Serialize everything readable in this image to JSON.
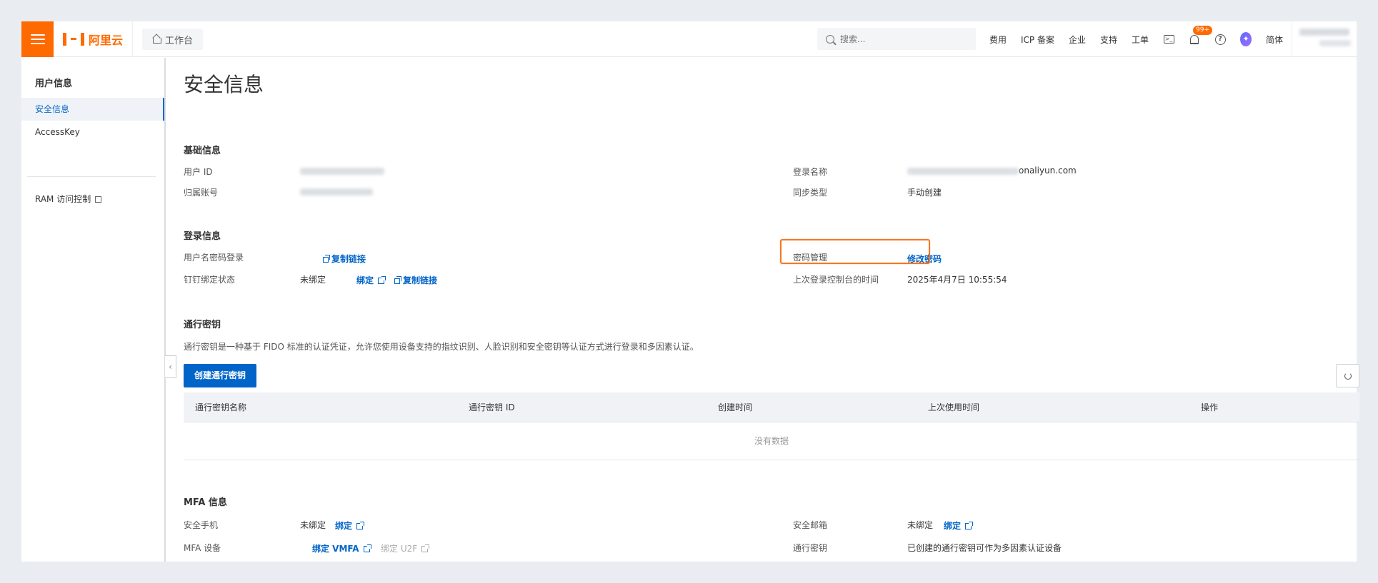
{
  "header": {
    "brand": "阿里云",
    "workbench_label": "工作台",
    "search_placeholder": "搜索...",
    "links": [
      "费用",
      "ICP 备案",
      "企业",
      "支持",
      "工单"
    ],
    "notification_badge": "99+",
    "language": "简体",
    "accent_color": "#ff6a00"
  },
  "sidebar": {
    "title": "用户信息",
    "items": [
      {
        "label": "安全信息",
        "active": true
      },
      {
        "label": "AccessKey",
        "active": false
      },
      {
        "label": "RAM 访问控制",
        "active": false
      }
    ]
  },
  "page": {
    "title": "安全信息",
    "basic": {
      "title": "基础信息",
      "user_id_label": "用户 ID",
      "account_label": "归属账号",
      "login_name_label": "登录名称",
      "login_name_suffix": "onaliyun.com",
      "sync_type_label": "同步类型",
      "sync_type_value": "手动创建"
    },
    "login": {
      "title": "登录信息",
      "pwd_login_label": "用户名密码登录",
      "copy_link": "复制链接",
      "dingtalk_label": "钉钉绑定状态",
      "unbound": "未绑定",
      "bind": "绑定",
      "pwd_manage_label": "密码管理",
      "change_pwd": "修改密码",
      "last_login_label": "上次登录控制台的时间",
      "last_login_value": "2025年4月7日 10:55:54"
    },
    "passkey": {
      "title": "通行密钥",
      "description": "通行密钥是一种基于 FIDO 标准的认证凭证，允许您使用设备支持的指纹识别、人脸识别和安全密钥等认证方式进行登录和多因素认证。",
      "create_button": "创建通行密钥",
      "columns": [
        "通行密钥名称",
        "通行密钥 ID",
        "创建时间",
        "上次使用时间",
        "操作"
      ],
      "empty_text": "没有数据"
    },
    "mfa": {
      "title": "MFA 信息",
      "phone_label": "安全手机",
      "phone_status": "未绑定",
      "phone_bind": "绑定",
      "device_label": "MFA 设备",
      "bind_vmfa": "绑定 VMFA",
      "bind_u2f": "绑定 U2F",
      "email_label": "安全邮箱",
      "email_status": "未绑定",
      "email_bind": "绑定",
      "passkey_label": "通行密钥",
      "passkey_value": "已创建的通行密钥可作为多因素认证设备"
    }
  }
}
